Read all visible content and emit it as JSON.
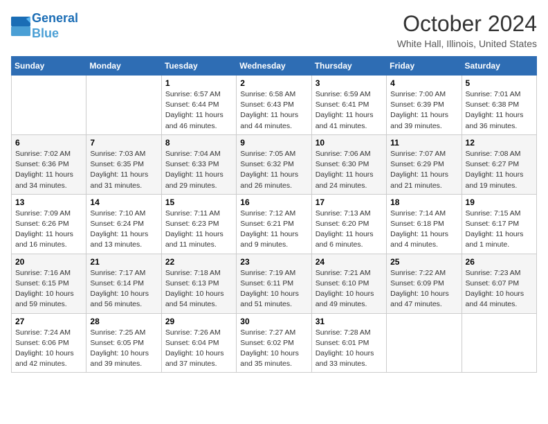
{
  "header": {
    "logo_line1": "General",
    "logo_line2": "Blue",
    "month": "October 2024",
    "location": "White Hall, Illinois, United States"
  },
  "weekdays": [
    "Sunday",
    "Monday",
    "Tuesday",
    "Wednesday",
    "Thursday",
    "Friday",
    "Saturday"
  ],
  "weeks": [
    [
      {
        "day": "",
        "sunrise": "",
        "sunset": "",
        "daylight": ""
      },
      {
        "day": "",
        "sunrise": "",
        "sunset": "",
        "daylight": ""
      },
      {
        "day": "1",
        "sunrise": "Sunrise: 6:57 AM",
        "sunset": "Sunset: 6:44 PM",
        "daylight": "Daylight: 11 hours and 46 minutes."
      },
      {
        "day": "2",
        "sunrise": "Sunrise: 6:58 AM",
        "sunset": "Sunset: 6:43 PM",
        "daylight": "Daylight: 11 hours and 44 minutes."
      },
      {
        "day": "3",
        "sunrise": "Sunrise: 6:59 AM",
        "sunset": "Sunset: 6:41 PM",
        "daylight": "Daylight: 11 hours and 41 minutes."
      },
      {
        "day": "4",
        "sunrise": "Sunrise: 7:00 AM",
        "sunset": "Sunset: 6:39 PM",
        "daylight": "Daylight: 11 hours and 39 minutes."
      },
      {
        "day": "5",
        "sunrise": "Sunrise: 7:01 AM",
        "sunset": "Sunset: 6:38 PM",
        "daylight": "Daylight: 11 hours and 36 minutes."
      }
    ],
    [
      {
        "day": "6",
        "sunrise": "Sunrise: 7:02 AM",
        "sunset": "Sunset: 6:36 PM",
        "daylight": "Daylight: 11 hours and 34 minutes."
      },
      {
        "day": "7",
        "sunrise": "Sunrise: 7:03 AM",
        "sunset": "Sunset: 6:35 PM",
        "daylight": "Daylight: 11 hours and 31 minutes."
      },
      {
        "day": "8",
        "sunrise": "Sunrise: 7:04 AM",
        "sunset": "Sunset: 6:33 PM",
        "daylight": "Daylight: 11 hours and 29 minutes."
      },
      {
        "day": "9",
        "sunrise": "Sunrise: 7:05 AM",
        "sunset": "Sunset: 6:32 PM",
        "daylight": "Daylight: 11 hours and 26 minutes."
      },
      {
        "day": "10",
        "sunrise": "Sunrise: 7:06 AM",
        "sunset": "Sunset: 6:30 PM",
        "daylight": "Daylight: 11 hours and 24 minutes."
      },
      {
        "day": "11",
        "sunrise": "Sunrise: 7:07 AM",
        "sunset": "Sunset: 6:29 PM",
        "daylight": "Daylight: 11 hours and 21 minutes."
      },
      {
        "day": "12",
        "sunrise": "Sunrise: 7:08 AM",
        "sunset": "Sunset: 6:27 PM",
        "daylight": "Daylight: 11 hours and 19 minutes."
      }
    ],
    [
      {
        "day": "13",
        "sunrise": "Sunrise: 7:09 AM",
        "sunset": "Sunset: 6:26 PM",
        "daylight": "Daylight: 11 hours and 16 minutes."
      },
      {
        "day": "14",
        "sunrise": "Sunrise: 7:10 AM",
        "sunset": "Sunset: 6:24 PM",
        "daylight": "Daylight: 11 hours and 13 minutes."
      },
      {
        "day": "15",
        "sunrise": "Sunrise: 7:11 AM",
        "sunset": "Sunset: 6:23 PM",
        "daylight": "Daylight: 11 hours and 11 minutes."
      },
      {
        "day": "16",
        "sunrise": "Sunrise: 7:12 AM",
        "sunset": "Sunset: 6:21 PM",
        "daylight": "Daylight: 11 hours and 9 minutes."
      },
      {
        "day": "17",
        "sunrise": "Sunrise: 7:13 AM",
        "sunset": "Sunset: 6:20 PM",
        "daylight": "Daylight: 11 hours and 6 minutes."
      },
      {
        "day": "18",
        "sunrise": "Sunrise: 7:14 AM",
        "sunset": "Sunset: 6:18 PM",
        "daylight": "Daylight: 11 hours and 4 minutes."
      },
      {
        "day": "19",
        "sunrise": "Sunrise: 7:15 AM",
        "sunset": "Sunset: 6:17 PM",
        "daylight": "Daylight: 11 hours and 1 minute."
      }
    ],
    [
      {
        "day": "20",
        "sunrise": "Sunrise: 7:16 AM",
        "sunset": "Sunset: 6:15 PM",
        "daylight": "Daylight: 10 hours and 59 minutes."
      },
      {
        "day": "21",
        "sunrise": "Sunrise: 7:17 AM",
        "sunset": "Sunset: 6:14 PM",
        "daylight": "Daylight: 10 hours and 56 minutes."
      },
      {
        "day": "22",
        "sunrise": "Sunrise: 7:18 AM",
        "sunset": "Sunset: 6:13 PM",
        "daylight": "Daylight: 10 hours and 54 minutes."
      },
      {
        "day": "23",
        "sunrise": "Sunrise: 7:19 AM",
        "sunset": "Sunset: 6:11 PM",
        "daylight": "Daylight: 10 hours and 51 minutes."
      },
      {
        "day": "24",
        "sunrise": "Sunrise: 7:21 AM",
        "sunset": "Sunset: 6:10 PM",
        "daylight": "Daylight: 10 hours and 49 minutes."
      },
      {
        "day": "25",
        "sunrise": "Sunrise: 7:22 AM",
        "sunset": "Sunset: 6:09 PM",
        "daylight": "Daylight: 10 hours and 47 minutes."
      },
      {
        "day": "26",
        "sunrise": "Sunrise: 7:23 AM",
        "sunset": "Sunset: 6:07 PM",
        "daylight": "Daylight: 10 hours and 44 minutes."
      }
    ],
    [
      {
        "day": "27",
        "sunrise": "Sunrise: 7:24 AM",
        "sunset": "Sunset: 6:06 PM",
        "daylight": "Daylight: 10 hours and 42 minutes."
      },
      {
        "day": "28",
        "sunrise": "Sunrise: 7:25 AM",
        "sunset": "Sunset: 6:05 PM",
        "daylight": "Daylight: 10 hours and 39 minutes."
      },
      {
        "day": "29",
        "sunrise": "Sunrise: 7:26 AM",
        "sunset": "Sunset: 6:04 PM",
        "daylight": "Daylight: 10 hours and 37 minutes."
      },
      {
        "day": "30",
        "sunrise": "Sunrise: 7:27 AM",
        "sunset": "Sunset: 6:02 PM",
        "daylight": "Daylight: 10 hours and 35 minutes."
      },
      {
        "day": "31",
        "sunrise": "Sunrise: 7:28 AM",
        "sunset": "Sunset: 6:01 PM",
        "daylight": "Daylight: 10 hours and 33 minutes."
      },
      {
        "day": "",
        "sunrise": "",
        "sunset": "",
        "daylight": ""
      },
      {
        "day": "",
        "sunrise": "",
        "sunset": "",
        "daylight": ""
      }
    ]
  ]
}
